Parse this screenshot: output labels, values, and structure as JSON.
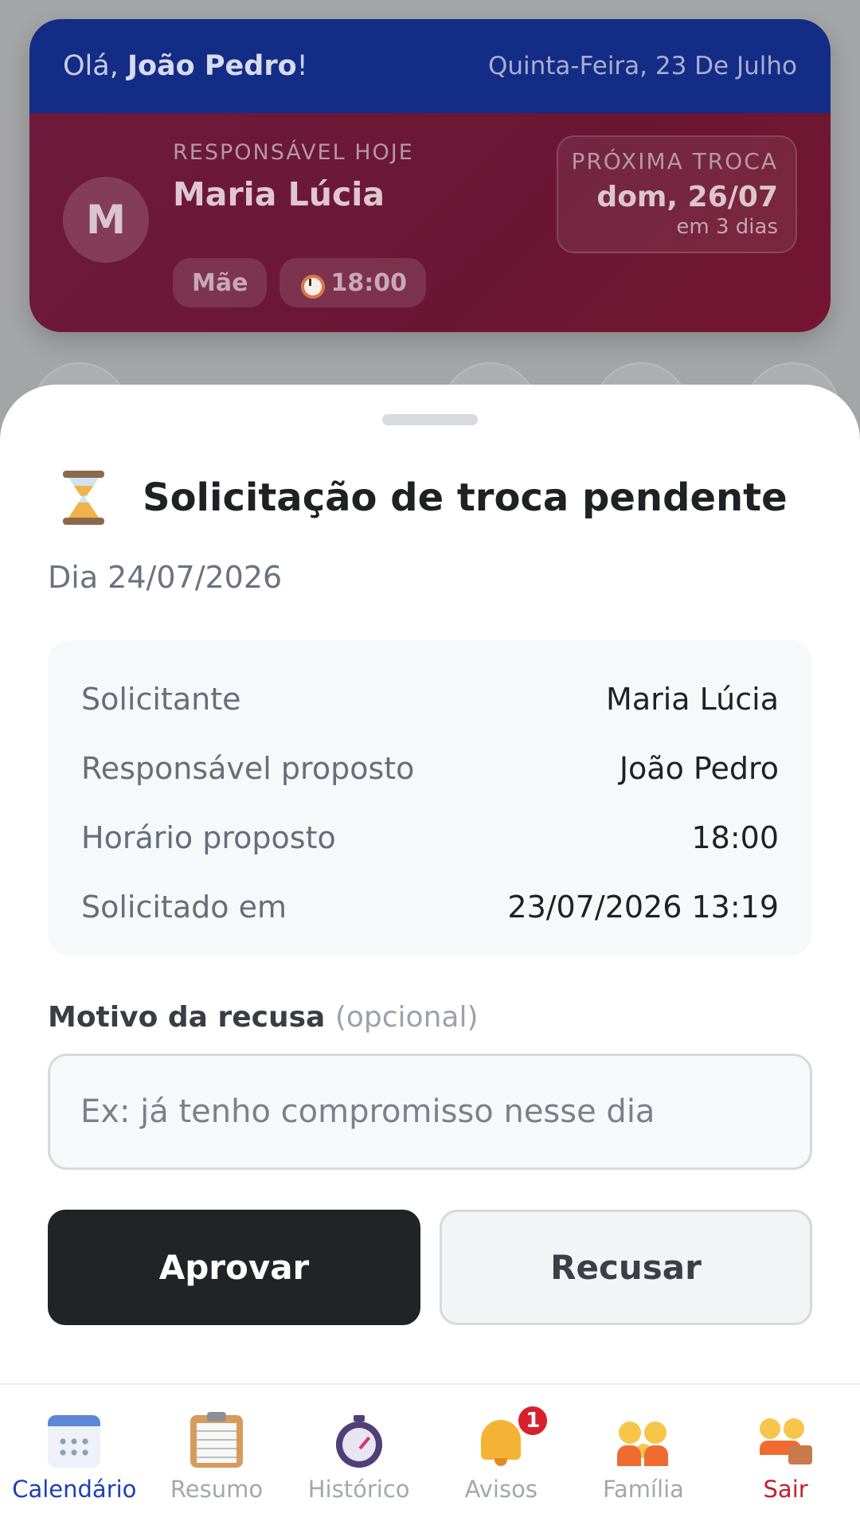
{
  "header": {
    "greeting_prefix": "Olá, ",
    "greeting_name": "João Pedro",
    "greeting_suffix": "!",
    "date": "Quinta-Feira, 23 De Julho",
    "responsible_label": "RESPONSÁVEL HOJE",
    "responsible_name": "Maria Lúcia",
    "avatar_initial": "M",
    "chips": {
      "role": "Mãe",
      "time": "18:00"
    },
    "next_swap": {
      "label": "PRÓXIMA TROCA",
      "date": "dom, 26/07",
      "days": "em 3 dias"
    }
  },
  "sheet": {
    "title": "Solicitação de troca pendente",
    "subtitle": "Dia 24/07/2026",
    "details": [
      {
        "key": "Solicitante",
        "value": "Maria Lúcia"
      },
      {
        "key": "Responsável proposto",
        "value": "João Pedro"
      },
      {
        "key": "Horário proposto",
        "value": "18:00"
      },
      {
        "key": "Solicitado em",
        "value": "23/07/2026 13:19"
      }
    ],
    "reason_label": "Motivo da recusa",
    "reason_optional": "(opcional)",
    "reason_placeholder": "Ex: já tenho compromisso nesse dia",
    "approve_label": "Aprovar",
    "reject_label": "Recusar"
  },
  "nav": {
    "items": [
      {
        "label": "Calendário",
        "icon": "calendar-icon"
      },
      {
        "label": "Resumo",
        "icon": "clipboard-icon"
      },
      {
        "label": "Histórico",
        "icon": "stopwatch-icon"
      },
      {
        "label": "Avisos",
        "icon": "bell-icon",
        "badge": "1"
      },
      {
        "label": "Família",
        "icon": "family-icon"
      },
      {
        "label": "Sair",
        "icon": "exit-icon"
      }
    ]
  },
  "colors": {
    "header_blue": "#132c86",
    "header_red": "#6e1a3c",
    "active_nav": "#1d3fb8",
    "exit_red": "#c4202f",
    "approve_bg": "#212427"
  }
}
